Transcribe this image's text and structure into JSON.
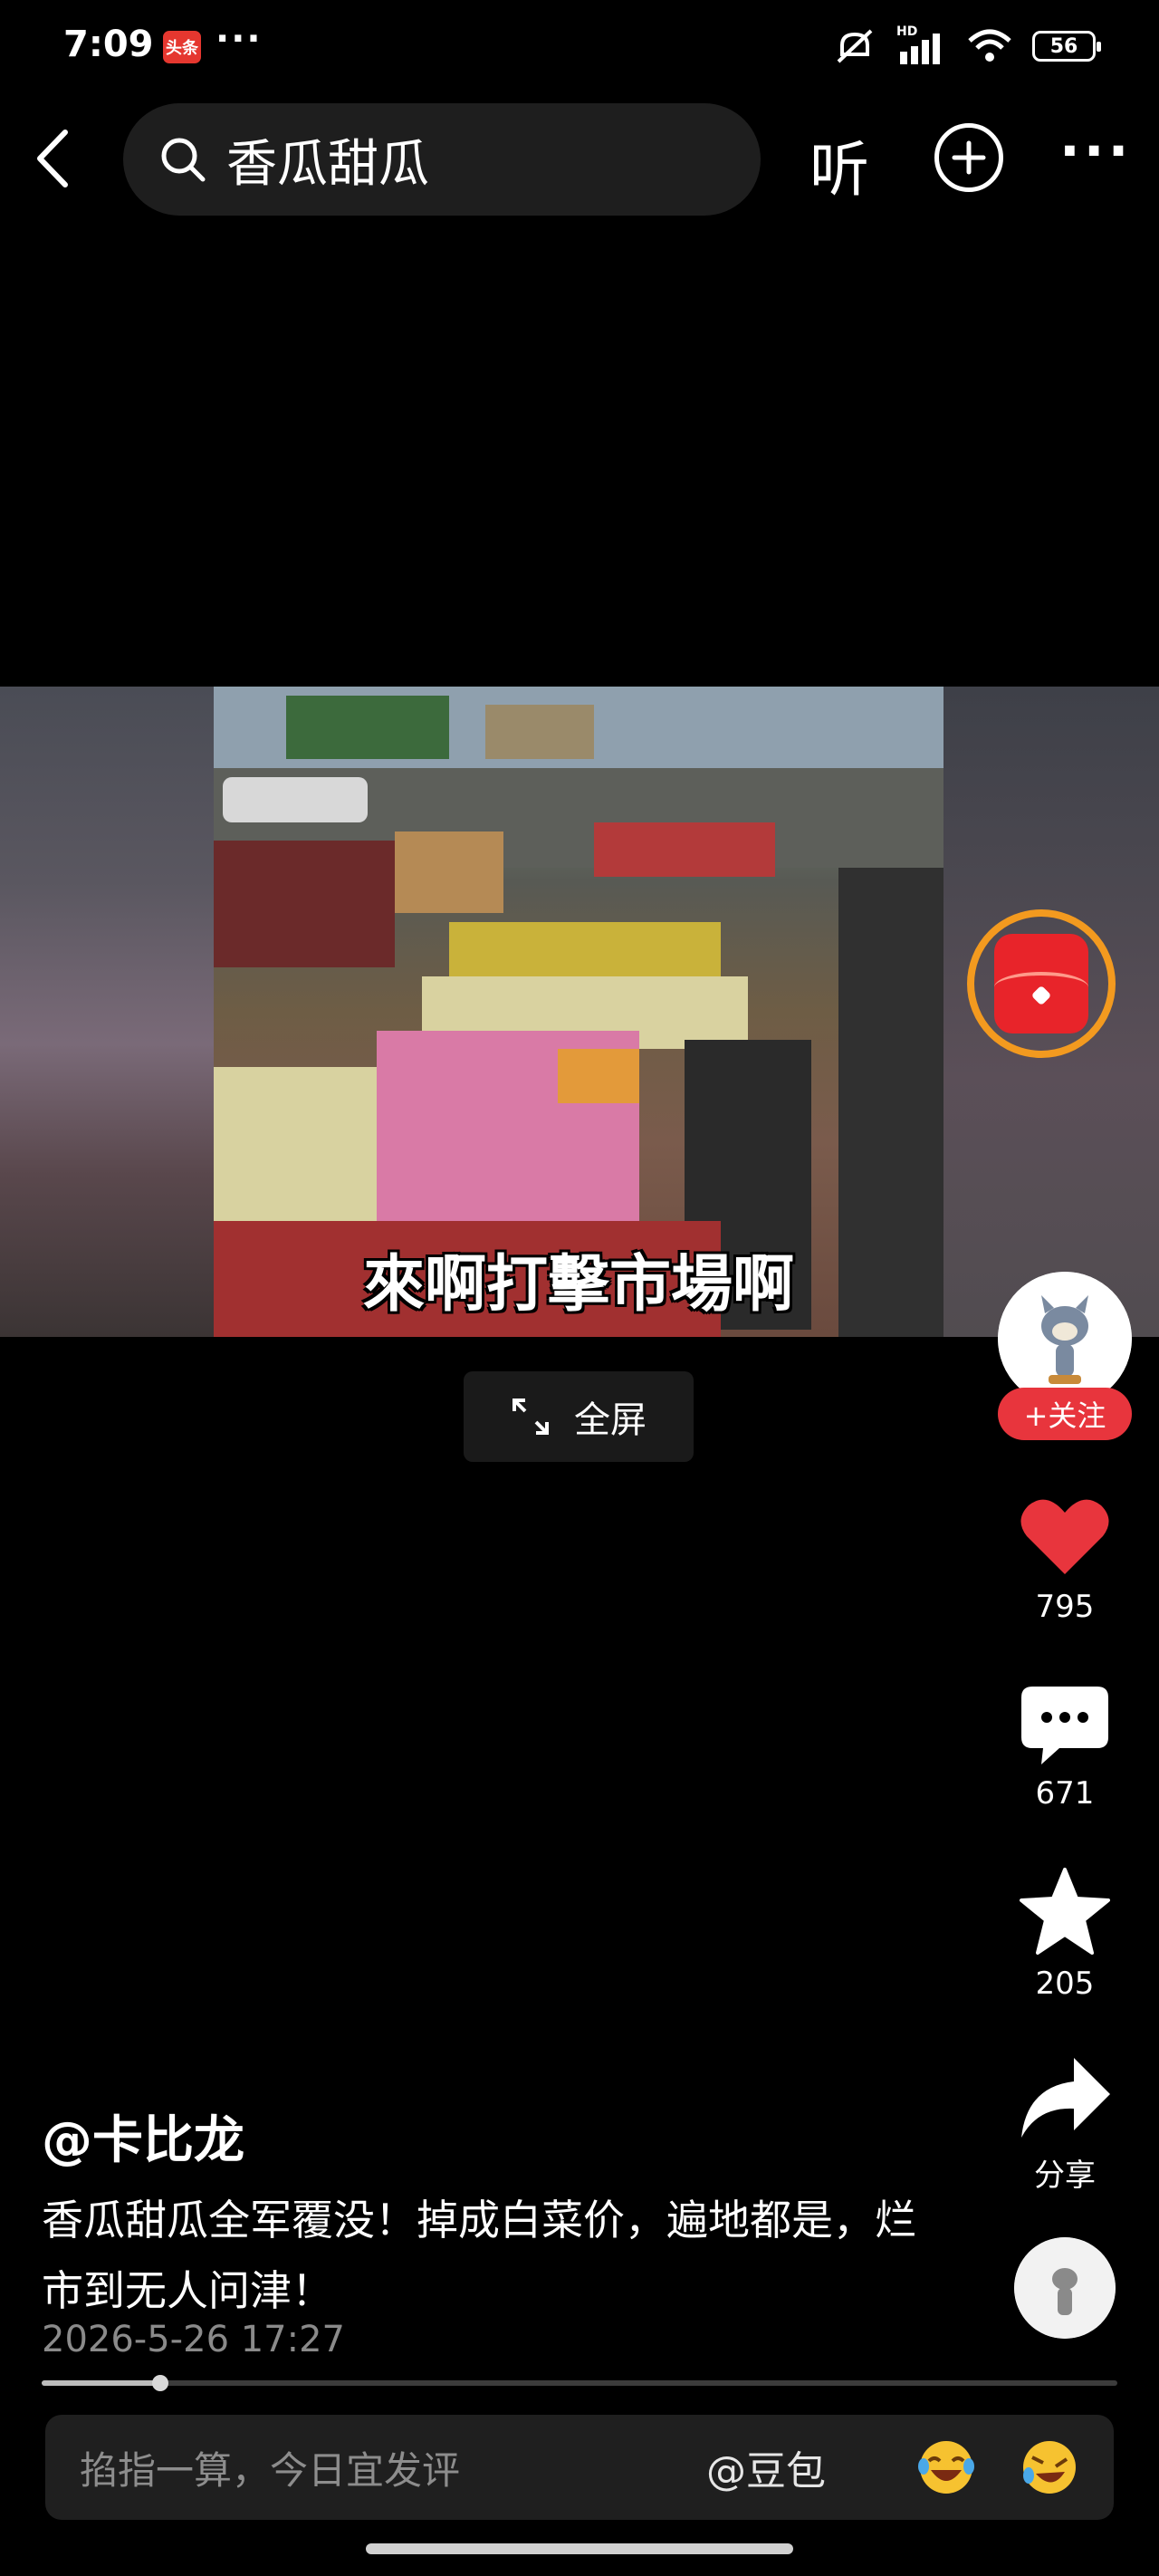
{
  "status_bar": {
    "time": "7:09",
    "app_badge": "头条",
    "dots": "···",
    "network": "HD",
    "battery": "56"
  },
  "top_bar": {
    "back_icon": "chevron-left-icon",
    "search_icon": "search-icon",
    "search_query": "香瓜甜瓜",
    "listen_label": "听",
    "add_icon": "plus-circle-icon",
    "more_label": "···"
  },
  "video": {
    "subtitle": "來啊打擊市場啊",
    "fullscreen_label": "全屏",
    "progress": 0.11
  },
  "right_rail": {
    "follow_label": "+关注",
    "likes": "795",
    "comments": "671",
    "favorites": "205",
    "share_label": "分享"
  },
  "post": {
    "author": "@卡比龙",
    "description": "香瓜甜瓜全军覆没！掉成白菜价，遍地都是，烂市到无人问津！",
    "timestamp": "2026-5-26 17:27"
  },
  "comment_bar": {
    "placeholder": "掐指一算，今日宜发评",
    "mention": "@豆包"
  },
  "colors": {
    "accent_red": "#e8353d",
    "ring_orange": "#f39a1f",
    "like_red": "#e8353d"
  }
}
